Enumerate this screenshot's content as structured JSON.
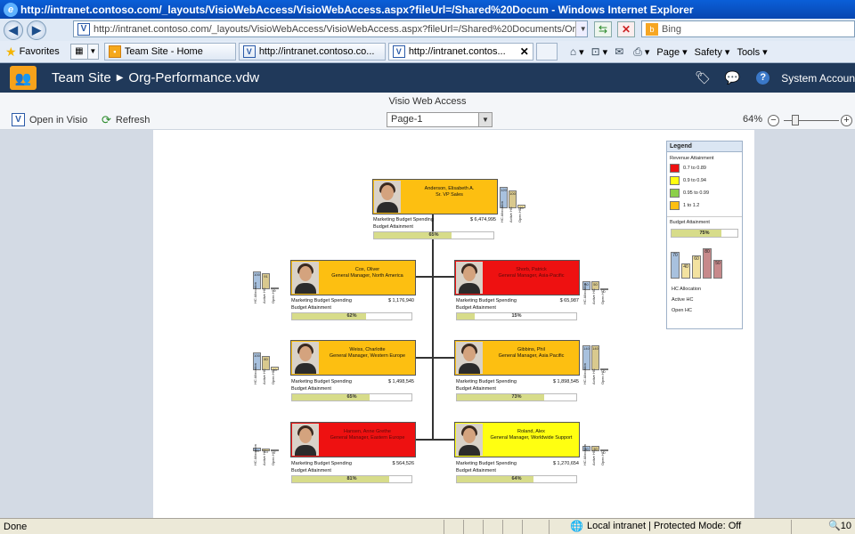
{
  "window": {
    "title": "http://intranet.contoso.com/_layouts/VisioWebAccess/VisioWebAccess.aspx?fileUrl=/Shared%20Docum - Windows Internet Explorer",
    "address": "http://intranet.contoso.com/_layouts/VisioWebAccess/VisioWebAccess.aspx?fileUrl=/Shared%20Documents/Or",
    "search_placeholder": "Bing"
  },
  "tabsbar": {
    "favorites_label": "Favorites",
    "tabs": [
      {
        "label": "Team Site - Home"
      },
      {
        "label": "http://intranet.contoso.co..."
      },
      {
        "label": "http://intranet.contos..."
      }
    ],
    "commands": {
      "page": "Page ▾",
      "safety": "Safety ▾",
      "tools": "Tools ▾"
    }
  },
  "sharepoint": {
    "site": "Team Site",
    "document": "Org-Performance.vdw",
    "account": "System Accoun"
  },
  "visio": {
    "title": "Visio Web Access",
    "open_label": "Open in Visio",
    "refresh_label": "Refresh",
    "page_selected": "Page-1",
    "zoom": "64%",
    "zoom_level": 0.64
  },
  "org": {
    "spend_label": "Marketing Budget Spending",
    "attain_label": "Budget Attainment",
    "hc_labels": [
      "HC Allocation",
      "Active HC",
      "Open HC"
    ],
    "root": {
      "name": "Anderson, Elisabeth A.",
      "role": "Sr. VP Sales",
      "spend": "$ 6,474,995",
      "attain": "65%",
      "attain_value": 0.65,
      "color": "#fdbf11",
      "hc": [
        120,
        100,
        20
      ],
      "hc_text": [
        "120",
        "100",
        "20"
      ]
    },
    "reports": [
      {
        "name": "Cox, Oliver",
        "role": "General Manager, North America",
        "spend": "$ 1,176,940",
        "attain": "62%",
        "attain_value": 0.62,
        "color": "#fdbf11",
        "hc": [
          100,
          91,
          9
        ],
        "hc_text": [
          "100",
          "91",
          "9"
        ]
      },
      {
        "name": "Shorb, Patrick",
        "role": "General Manager, Asia-Pacific",
        "spend": "$ 65,987",
        "attain": "15%",
        "attain_value": 0.15,
        "color": "#ee1111",
        "hc": [
          50,
          50,
          0
        ],
        "hc_text": [
          "50",
          "50",
          "0"
        ]
      },
      {
        "name": "Weiss, Charlotte",
        "role": "General Manager, Western Europe",
        "spend": "$ 1,498,545",
        "attain": "65%",
        "attain_value": 0.65,
        "color": "#fdbf11",
        "hc": [
          100,
          80,
          20
        ],
        "hc_text": [
          "100",
          "80",
          "20"
        ]
      },
      {
        "name": "Gibbins, Phil",
        "role": "General Manager, Asia Pacific",
        "spend": "$ 1,898,545",
        "attain": "73%",
        "attain_value": 0.73,
        "color": "#fdbf11",
        "hc": [
          140,
          140,
          0
        ],
        "hc_text": [
          "140",
          "140",
          "0"
        ]
      },
      {
        "name": "Hansen, Anne Grethe",
        "role": "General Manager, Eastern Europe",
        "spend": "$ 564,526",
        "attain": "81%",
        "attain_value": 0.81,
        "color": "#ee1111",
        "hc": [
          20,
          13,
          7
        ],
        "hc_text": [
          "20",
          "13",
          "7"
        ]
      },
      {
        "name": "Roland, Alex",
        "role": "General Manager, Worldwide Support",
        "spend": "$ 1,270,654",
        "attain": "64%",
        "attain_value": 0.64,
        "color": "#ffff11",
        "hc": [
          30,
          30,
          0
        ],
        "hc_text": [
          "30",
          "30",
          "0"
        ]
      }
    ]
  },
  "legend": {
    "title": "Legend",
    "revenue_title": "Revenue Attainment",
    "items": [
      {
        "label": "0.7 to 0.89",
        "color": "#ee1111"
      },
      {
        "label": "0.9 to 0.94",
        "color": "#ffff11"
      },
      {
        "label": "0.95 to 0.99",
        "color": "#8ccf4a"
      },
      {
        "label": "1 to 1.2",
        "color": "#fdbf11"
      }
    ],
    "budget_title": "Budget Attainment",
    "budget_pct": "75%",
    "budget_value": 0.75,
    "hc_sample": [
      "70",
      "40",
      "60",
      "80",
      "50"
    ],
    "hc_sample_values": [
      70,
      40,
      60,
      80,
      50
    ],
    "hc_title": "HC Allocation",
    "active_label": "Active HC",
    "open_label": "Open HC"
  },
  "status": {
    "text": "Done",
    "zone": "Local intranet | Protected Mode: Off",
    "zoom": "10"
  }
}
